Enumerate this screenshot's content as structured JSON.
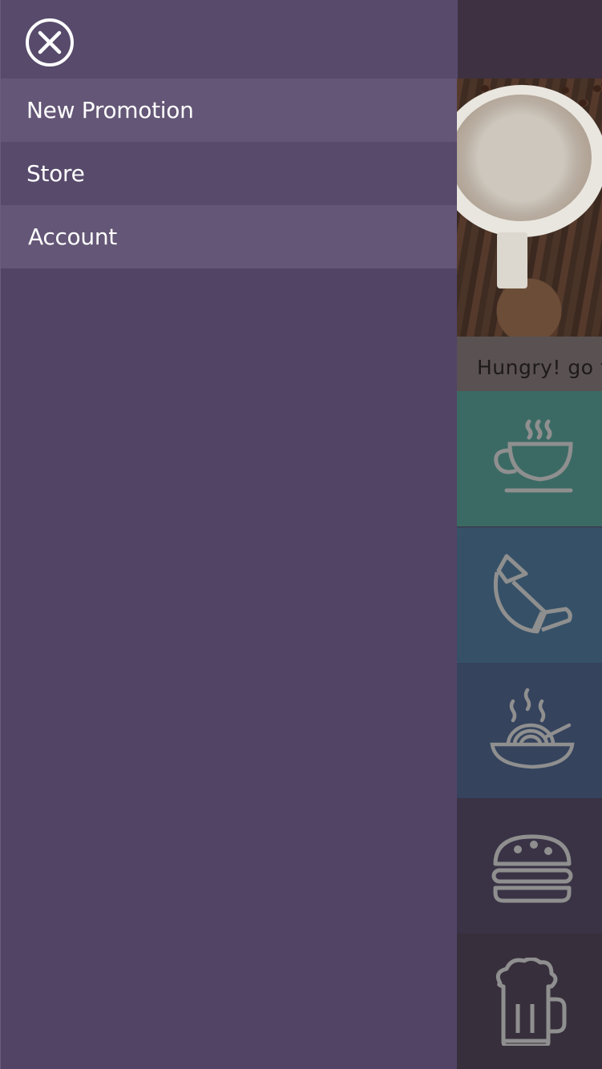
{
  "drawer": {
    "close_icon": "close-circle-icon",
    "items": [
      {
        "label": "New Promotion"
      },
      {
        "label": "Store"
      },
      {
        "label": "Account"
      }
    ]
  },
  "background": {
    "hero_caption": "Hungry! go to",
    "tiles": [
      {
        "icon": "coffee-cup-icon",
        "color": "#3b6a64"
      },
      {
        "icon": "croissant-icon",
        "color": "#365167"
      },
      {
        "icon": "noodle-bowl-icon",
        "color": "#35435d"
      },
      {
        "icon": "burger-icon",
        "color": "#3a3346"
      },
      {
        "icon": "beer-mug-icon",
        "color": "#382f3c"
      }
    ]
  },
  "colors": {
    "drawer_bg": "#524465",
    "drawer_item_highlight": "#645676",
    "text": "#ffffff"
  }
}
